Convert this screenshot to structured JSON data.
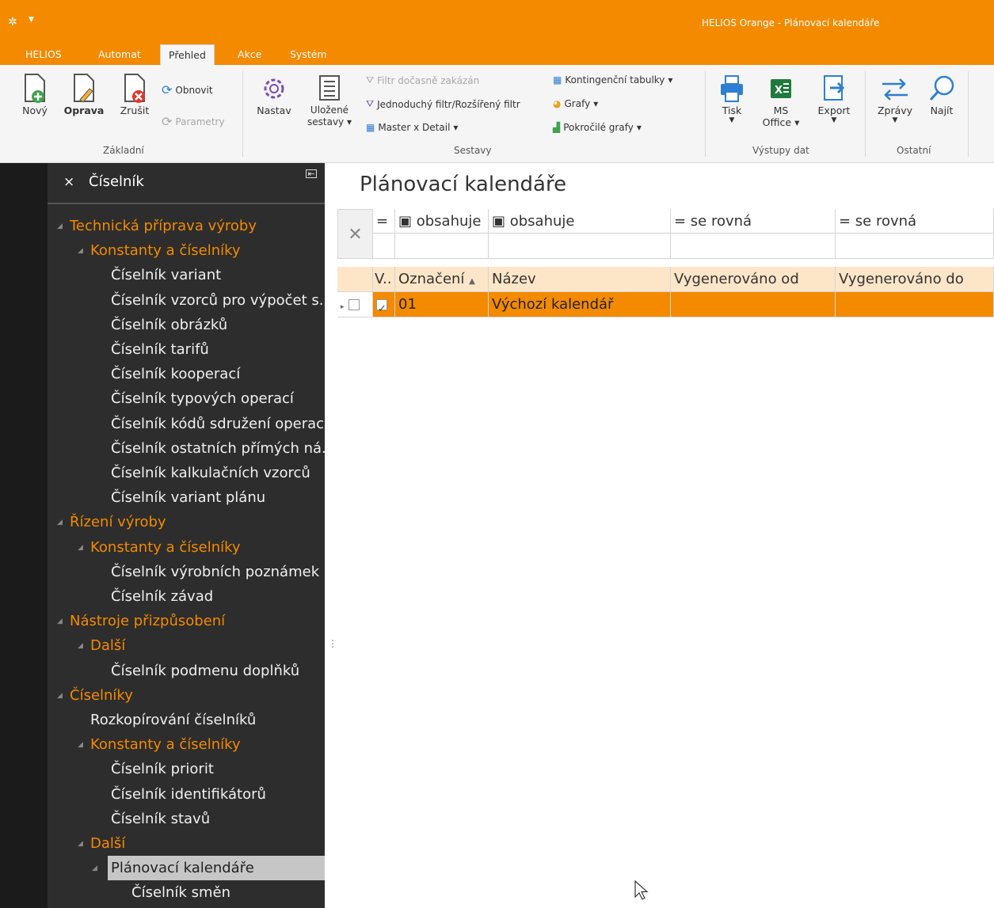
{
  "window": {
    "title": "HELIOS Orange - Plánovací kalendáře"
  },
  "tabs": [
    "HELIOS",
    "Automat",
    "Přehled",
    "Akce",
    "Systém"
  ],
  "ribbon": {
    "zakladni": {
      "group": "Základní",
      "novy": "Nový",
      "oprava": "Oprava",
      "zrusit": "Zrušit",
      "obnovit": "Obnovit",
      "parametry": "Parametry"
    },
    "sestavy": {
      "group": "Sestavy",
      "nastav": "Nastav",
      "ulozene1": "Uložené",
      "ulozene2": "sestavy",
      "filtr_zakazan": "Filtr dočasně zakázán",
      "jednoduchy": "Jednoduchý filtr/Rozšířený filtr",
      "master": "Master x Detail",
      "kontingencni": "Kontingenční tabulky",
      "grafy": "Grafy",
      "pokrocile": "Pokročilé grafy"
    },
    "vystupy": {
      "group": "Výstupy dat",
      "tisk": "Tisk",
      "ms1": "MS",
      "ms2": "Office",
      "export": "Export"
    },
    "ostatni": {
      "group": "Ostatní",
      "zpravy": "Zprávy",
      "najit": "Najít"
    },
    "colors": {
      "accent": "#f38a00"
    }
  },
  "nav": {
    "title": "Číselník",
    "items": [
      {
        "label": "Technická příprava výroby",
        "level": 0,
        "type": "cat"
      },
      {
        "label": "Konstanty a číselníky",
        "level": 1,
        "type": "cat"
      },
      {
        "label": "Číselník variant",
        "level": 2,
        "type": "leaf"
      },
      {
        "label": "Číselník vzorců pro výpočet s...",
        "level": 2,
        "type": "leaf"
      },
      {
        "label": "Číselník obrázků",
        "level": 2,
        "type": "leaf"
      },
      {
        "label": "Číselník tarifů",
        "level": 2,
        "type": "leaf"
      },
      {
        "label": "Číselník kooperací",
        "level": 2,
        "type": "leaf"
      },
      {
        "label": "Číselník typových operací",
        "level": 2,
        "type": "leaf"
      },
      {
        "label": "Číselník kódů sdružení operací",
        "level": 2,
        "type": "leaf"
      },
      {
        "label": "Číselník ostatních přímých ná...",
        "level": 2,
        "type": "leaf"
      },
      {
        "label": "Číselník kalkulačních vzorců",
        "level": 2,
        "type": "leaf"
      },
      {
        "label": "Číselník variant plánu",
        "level": 2,
        "type": "leaf"
      },
      {
        "label": "Řízení výroby",
        "level": 0,
        "type": "cat"
      },
      {
        "label": "Konstanty a číselníky",
        "level": 1,
        "type": "cat"
      },
      {
        "label": "Číselník výrobních poznámek",
        "level": 2,
        "type": "leaf"
      },
      {
        "label": "Číselník závad",
        "level": 2,
        "type": "leaf"
      },
      {
        "label": "Nástroje přizpůsobení",
        "level": 0,
        "type": "cat"
      },
      {
        "label": "Další",
        "level": 1,
        "type": "cat"
      },
      {
        "label": "Číselník podmenu doplňků",
        "level": 2,
        "type": "leaf"
      },
      {
        "label": "Číselníky",
        "level": 0,
        "type": "cat"
      },
      {
        "label": "Rozkopírování číselníků",
        "level": 1,
        "type": "leaf"
      },
      {
        "label": "Konstanty a číselníky",
        "level": 1,
        "type": "cat"
      },
      {
        "label": "Číselník priorit",
        "level": 2,
        "type": "leaf"
      },
      {
        "label": "Číselník identifikátorů",
        "level": 2,
        "type": "leaf"
      },
      {
        "label": "Číselník stavů",
        "level": 2,
        "type": "leaf"
      },
      {
        "label": "Další",
        "level": 1,
        "type": "cat"
      },
      {
        "label": "Plánovací kalendáře",
        "level": 2,
        "type": "sel"
      },
      {
        "label": "Číselník směn",
        "level": 3,
        "type": "leaf"
      }
    ]
  },
  "main": {
    "title": "Plánovací kalendáře",
    "filters": [
      "=",
      "obsahuje",
      "obsahuje",
      "= se rovná",
      "= se rovná"
    ],
    "columns": [
      "V..",
      "Označení",
      "Název",
      "Vygenerováno od",
      "Vygenerováno do"
    ],
    "rows": [
      {
        "v": true,
        "oznaceni": "01",
        "nazev": "Výchozí kalendář",
        "od": "",
        "do": ""
      }
    ]
  }
}
